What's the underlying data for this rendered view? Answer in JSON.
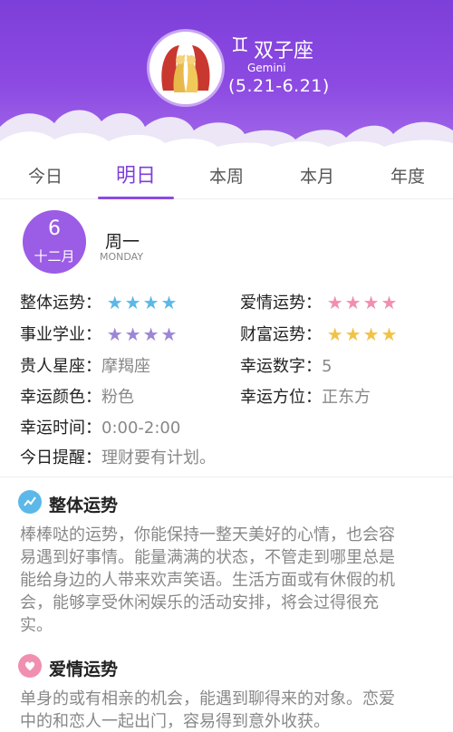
{
  "header": {
    "symbol": "♊",
    "name": "双子座",
    "english": "Gemini",
    "date_range": "(5.21-6.21)",
    "sign_icon": "gemini-twins-icon",
    "colors": {
      "primary": "#8c4ae2",
      "dark": "#7d3fd9"
    }
  },
  "tabs": [
    {
      "label": "今日",
      "active": false
    },
    {
      "label": "明日",
      "active": true
    },
    {
      "label": "本周",
      "active": false
    },
    {
      "label": "本月",
      "active": false
    },
    {
      "label": "年度",
      "active": false
    }
  ],
  "date": {
    "day": "6",
    "month": "十二月",
    "weekday_cn": "周一",
    "weekday_en": "MONDAY"
  },
  "ratings": {
    "overall": {
      "label": "整体运势：",
      "stars": 4,
      "color": "#5bb8e8"
    },
    "love": {
      "label": "爱情运势：",
      "stars": 4,
      "color": "#f08fb0"
    },
    "career": {
      "label": "事业学业：",
      "stars": 4,
      "color": "#9c86d6"
    },
    "wealth": {
      "label": "财富运势：",
      "stars": 4,
      "color": "#f0c347"
    }
  },
  "details": {
    "noble_sign": {
      "label": "贵人星座：",
      "value": "摩羯座"
    },
    "lucky_number": {
      "label": "幸运数字：",
      "value": "5"
    },
    "lucky_color": {
      "label": "幸运颜色：",
      "value": "粉色"
    },
    "lucky_direction": {
      "label": "幸运方位：",
      "value": "正东方"
    },
    "lucky_time": {
      "label": "幸运时间：",
      "value": "0:00-2:00"
    },
    "reminder": {
      "label": "今日提醒：",
      "value": "理财要有计划。"
    }
  },
  "sections": {
    "overall": {
      "title": "整体运势",
      "icon": "trend-chart-icon",
      "lines": [
        "棒棒哒的运势，你能保持一整天美好的心情，也会容",
        "易遇到好事情。能量满满的状态，不管走到哪里总是",
        "能给身边的人带来欢声笑语。生活方面或有休假的机",
        "会，能够享受休闲娱乐的活动安排，将会过得很充",
        "实。"
      ]
    },
    "love": {
      "title": "爱情运势",
      "icon": "heart-icon",
      "lines": [
        "单身的或有相亲的机会，能遇到聊得来的对象。恋爱",
        "中的和恋人一起出门，容易得到意外收获。"
      ]
    }
  }
}
